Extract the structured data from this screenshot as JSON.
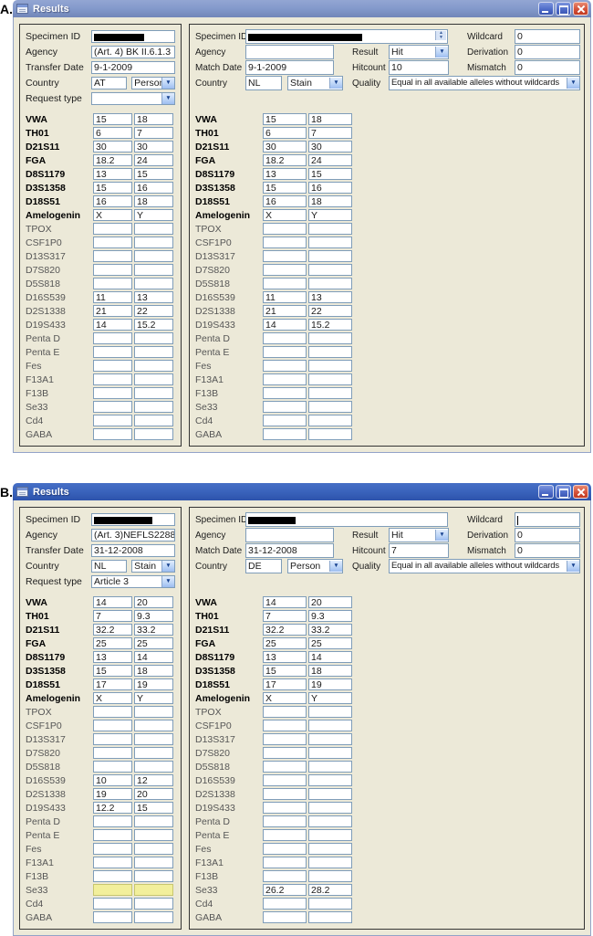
{
  "figure": {
    "label_a": "A.",
    "label_b": "B."
  },
  "colors": {
    "titlebar_active": "#3a63bc",
    "titlebar_inactive": "#8399cb",
    "window_bg": "#ece9d8",
    "field_border": "#7f9db9",
    "panel_border": "#343434",
    "highlight_yellow": "#f2ef9b",
    "close_button_red": "#d4523a",
    "redaction_black": "#000000"
  },
  "icons": {
    "dropdown_arrow": "▼",
    "spinner_up": "▲",
    "spinner_down": "▼"
  },
  "windows": {
    "a": {
      "title": "Results",
      "left": {
        "specimen_label": "Specimen ID",
        "agency_label": "Agency",
        "agency": "(Art. 4) BK II.6.1.3",
        "date_label": "Transfer Date",
        "date": "9-1-2009",
        "country_label": "Country",
        "country": "AT",
        "sample_type": "Person",
        "request_label": "Request type",
        "request": "",
        "loci": [
          {
            "name": "VWA",
            "bold": true,
            "v1": "15",
            "v2": "18"
          },
          {
            "name": "TH01",
            "bold": true,
            "v1": "6",
            "v2": "7"
          },
          {
            "name": "D21S11",
            "bold": true,
            "v1": "30",
            "v2": "30"
          },
          {
            "name": "FGA",
            "bold": true,
            "v1": "18.2",
            "v2": "24"
          },
          {
            "name": "D8S1179",
            "bold": true,
            "v1": "13",
            "v2": "15"
          },
          {
            "name": "D3S1358",
            "bold": true,
            "v1": "15",
            "v2": "16"
          },
          {
            "name": "D18S51",
            "bold": true,
            "v1": "16",
            "v2": "18"
          },
          {
            "name": "Amelogenin",
            "bold": true,
            "v1": "X",
            "v2": "Y"
          },
          {
            "name": "TPOX"
          },
          {
            "name": "CSF1P0"
          },
          {
            "name": "D13S317"
          },
          {
            "name": "D7S820"
          },
          {
            "name": "D5S818"
          },
          {
            "name": "D16S539",
            "v1": "11",
            "v2": "13"
          },
          {
            "name": "D2S1338",
            "v1": "21",
            "v2": "22"
          },
          {
            "name": "D19S433",
            "v1": "14",
            "v2": "15.2"
          },
          {
            "name": "Penta D"
          },
          {
            "name": "Penta E"
          },
          {
            "name": "Fes"
          },
          {
            "name": "F13A1"
          },
          {
            "name": "F13B"
          },
          {
            "name": "Se33"
          },
          {
            "name": "Cd4"
          },
          {
            "name": "GABA"
          }
        ]
      },
      "right": {
        "specimen_label": "Specimen ID",
        "agency_label": "Agency",
        "agency": "",
        "date_label": "Match Date",
        "date": "9-1-2009",
        "country_label": "Country",
        "country": "NL",
        "sample_type": "Stain",
        "result_label": "Result",
        "result": "Hit",
        "hitcount_label": "Hitcount",
        "hitcount": "10",
        "quality_label": "Quality",
        "quality": "Equal in all available alleles without wildcards",
        "wildcard_label": "Wildcard",
        "wildcard": "0",
        "derivation_label": "Derivation",
        "derivation": "0",
        "mismatch_label": "Mismatch",
        "mismatch": "0",
        "loci": [
          {
            "name": "VWA",
            "bold": true,
            "v1": "15",
            "v2": "18"
          },
          {
            "name": "TH01",
            "bold": true,
            "v1": "6",
            "v2": "7"
          },
          {
            "name": "D21S11",
            "bold": true,
            "v1": "30",
            "v2": "30"
          },
          {
            "name": "FGA",
            "bold": true,
            "v1": "18.2",
            "v2": "24"
          },
          {
            "name": "D8S1179",
            "bold": true,
            "v1": "13",
            "v2": "15"
          },
          {
            "name": "D3S1358",
            "bold": true,
            "v1": "15",
            "v2": "16"
          },
          {
            "name": "D18S51",
            "bold": true,
            "v1": "16",
            "v2": "18"
          },
          {
            "name": "Amelogenin",
            "bold": true,
            "v1": "X",
            "v2": "Y"
          },
          {
            "name": "TPOX"
          },
          {
            "name": "CSF1P0"
          },
          {
            "name": "D13S317"
          },
          {
            "name": "D7S820"
          },
          {
            "name": "D5S818"
          },
          {
            "name": "D16S539",
            "v1": "11",
            "v2": "13"
          },
          {
            "name": "D2S1338",
            "v1": "21",
            "v2": "22"
          },
          {
            "name": "D19S433",
            "v1": "14",
            "v2": "15.2"
          },
          {
            "name": "Penta D"
          },
          {
            "name": "Penta E"
          },
          {
            "name": "Fes"
          },
          {
            "name": "F13A1"
          },
          {
            "name": "F13B"
          },
          {
            "name": "Se33"
          },
          {
            "name": "Cd4"
          },
          {
            "name": "GABA"
          }
        ]
      }
    },
    "b": {
      "title": "Results",
      "left": {
        "specimen_label": "Specimen ID",
        "agency_label": "Agency",
        "agency": "(Art. 3)NEFLS2288",
        "date_label": "Transfer Date",
        "date": "31-12-2008",
        "country_label": "Country",
        "country": "NL",
        "sample_type": "Stain",
        "request_label": "Request type",
        "request": "Article 3",
        "loci": [
          {
            "name": "VWA",
            "bold": true,
            "v1": "14",
            "v2": "20"
          },
          {
            "name": "TH01",
            "bold": true,
            "v1": "7",
            "v2": "9.3"
          },
          {
            "name": "D21S11",
            "bold": true,
            "v1": "32.2",
            "v2": "33.2"
          },
          {
            "name": "FGA",
            "bold": true,
            "v1": "25",
            "v2": "25"
          },
          {
            "name": "D8S1179",
            "bold": true,
            "v1": "13",
            "v2": "14"
          },
          {
            "name": "D3S1358",
            "bold": true,
            "v1": "15",
            "v2": "18"
          },
          {
            "name": "D18S51",
            "bold": true,
            "v1": "17",
            "v2": "19"
          },
          {
            "name": "Amelogenin",
            "bold": true,
            "v1": "X",
            "v2": "Y"
          },
          {
            "name": "TPOX"
          },
          {
            "name": "CSF1P0"
          },
          {
            "name": "D13S317"
          },
          {
            "name": "D7S820"
          },
          {
            "name": "D5S818"
          },
          {
            "name": "D16S539",
            "v1": "10",
            "v2": "12"
          },
          {
            "name": "D2S1338",
            "v1": "19",
            "v2": "20"
          },
          {
            "name": "D19S433",
            "v1": "12.2",
            "v2": "15"
          },
          {
            "name": "Penta D"
          },
          {
            "name": "Penta E"
          },
          {
            "name": "Fes"
          },
          {
            "name": "F13A1"
          },
          {
            "name": "F13B"
          },
          {
            "name": "Se33",
            "highlight": true
          },
          {
            "name": "Cd4"
          },
          {
            "name": "GABA"
          }
        ]
      },
      "right": {
        "specimen_label": "Specimen ID",
        "agency_label": "Agency",
        "agency": "",
        "date_label": "Match Date",
        "date": "31-12-2008",
        "country_label": "Country",
        "country": "DE",
        "sample_type": "Person",
        "result_label": "Result",
        "result": "Hit",
        "hitcount_label": "Hitcount",
        "hitcount": "7",
        "quality_label": "Quality",
        "quality": "Equal in all available alleles without wildcards",
        "wildcard_label": "Wildcard",
        "wildcard": "",
        "derivation_label": "Derivation",
        "derivation": "0",
        "mismatch_label": "Mismatch",
        "mismatch": "0",
        "loci": [
          {
            "name": "VWA",
            "bold": true,
            "v1": "14",
            "v2": "20"
          },
          {
            "name": "TH01",
            "bold": true,
            "v1": "7",
            "v2": "9.3"
          },
          {
            "name": "D21S11",
            "bold": true,
            "v1": "32.2",
            "v2": "33.2"
          },
          {
            "name": "FGA",
            "bold": true,
            "v1": "25",
            "v2": "25"
          },
          {
            "name": "D8S1179",
            "bold": true,
            "v1": "13",
            "v2": "14"
          },
          {
            "name": "D3S1358",
            "bold": true,
            "v1": "15",
            "v2": "18"
          },
          {
            "name": "D18S51",
            "bold": true,
            "v1": "17",
            "v2": "19"
          },
          {
            "name": "Amelogenin",
            "bold": true,
            "v1": "X",
            "v2": "Y"
          },
          {
            "name": "TPOX"
          },
          {
            "name": "CSF1P0"
          },
          {
            "name": "D13S317"
          },
          {
            "name": "D7S820"
          },
          {
            "name": "D5S818"
          },
          {
            "name": "D16S539"
          },
          {
            "name": "D2S1338"
          },
          {
            "name": "D19S433"
          },
          {
            "name": "Penta D"
          },
          {
            "name": "Penta E"
          },
          {
            "name": "Fes"
          },
          {
            "name": "F13A1"
          },
          {
            "name": "F13B"
          },
          {
            "name": "Se33",
            "v1": "26.2",
            "v2": "28.2"
          },
          {
            "name": "Cd4"
          },
          {
            "name": "GABA"
          }
        ]
      }
    }
  }
}
